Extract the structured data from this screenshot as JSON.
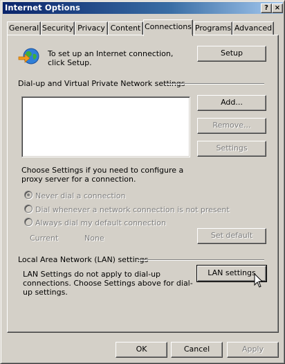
{
  "window": {
    "title": "Internet Options",
    "help_glyph": "?",
    "close_glyph": "×"
  },
  "tabs": [
    {
      "label": "General",
      "active": false
    },
    {
      "label": "Security",
      "active": false
    },
    {
      "label": "Privacy",
      "active": false
    },
    {
      "label": "Content",
      "active": false
    },
    {
      "label": "Connections",
      "active": true
    },
    {
      "label": "Programs",
      "active": false
    },
    {
      "label": "Advanced",
      "active": false
    }
  ],
  "setup": {
    "text": "To set up an Internet connection, click Setup.",
    "button": "Setup",
    "icon": "network-globe-icon"
  },
  "dialup": {
    "heading": "Dial-up and Virtual Private Network settings",
    "add_button": "Add...",
    "remove_button": "Remove...",
    "settings_button": "Settings",
    "hint": "Choose Settings if you need to configure a proxy server for a connection.",
    "radios": [
      {
        "label": "Never dial a connection",
        "selected": true
      },
      {
        "label": "Dial whenever a network connection is not present",
        "selected": false
      },
      {
        "label": "Always dial my default connection",
        "selected": false
      }
    ],
    "current_label": "Current",
    "current_value": "None",
    "set_default_button": "Set default"
  },
  "lan": {
    "heading": "Local Area Network (LAN) settings",
    "text": "LAN Settings do not apply to dial-up connections. Choose Settings above for dial-up settings.",
    "button": "LAN settings"
  },
  "footer": {
    "ok": "OK",
    "cancel": "Cancel",
    "apply": "Apply"
  },
  "colors": {
    "titlebar_start": "#0a246a",
    "titlebar_end": "#a6caf0",
    "face": "#d4d0c8",
    "disabled_text": "#808080"
  }
}
